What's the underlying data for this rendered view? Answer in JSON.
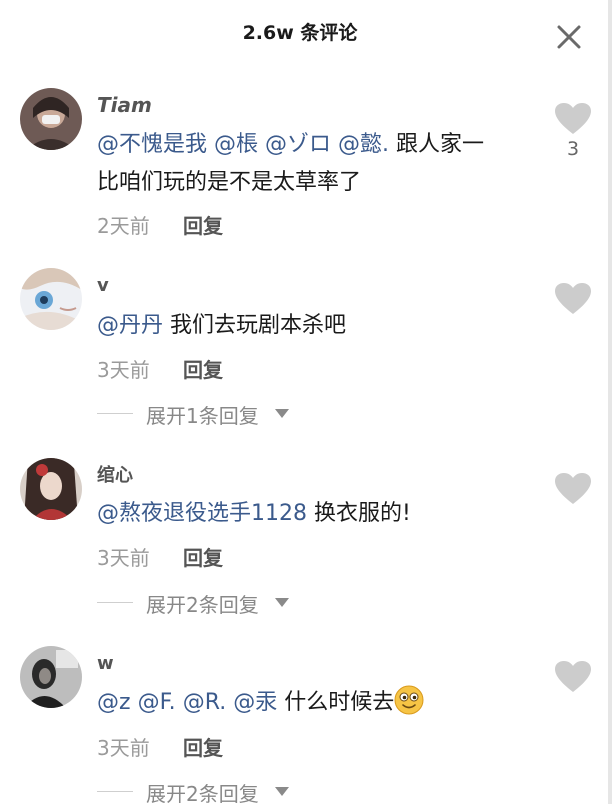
{
  "header": {
    "title": "2.6w 条评论",
    "close_icon": "close-icon"
  },
  "comments": [
    {
      "username": "Tiam",
      "mentions": [
        "@不愧是我",
        "@棖",
        "@ゾロ",
        "@懿."
      ],
      "text_line1_rest": "跟人家一",
      "text_line2": "比咱们玩的是不是太草率了",
      "time": "2天前",
      "reply": "回复",
      "likes": "3"
    },
    {
      "username": "v",
      "mentions": [
        "@丹丹"
      ],
      "text": "我们去玩剧本杀吧",
      "time": "3天前",
      "reply": "回复",
      "expand": "展开1条回复"
    },
    {
      "username": "绾心",
      "mentions": [
        "@熬夜退役选手1128"
      ],
      "text": "换衣服的!",
      "time": "3天前",
      "reply": "回复",
      "expand": "展开2条回复"
    },
    {
      "username": "w",
      "mentions": [
        "@z",
        "@F.",
        "@R.",
        "@汞"
      ],
      "text": "什么时候去",
      "emoji": "smiling-face-emoji",
      "time": "3天前",
      "reply": "回复",
      "expand": "展开2条回复"
    }
  ],
  "colors": {
    "mention": "#3b5a8c",
    "like_icon": "#cccccc",
    "meta": "#9a9a9a"
  }
}
